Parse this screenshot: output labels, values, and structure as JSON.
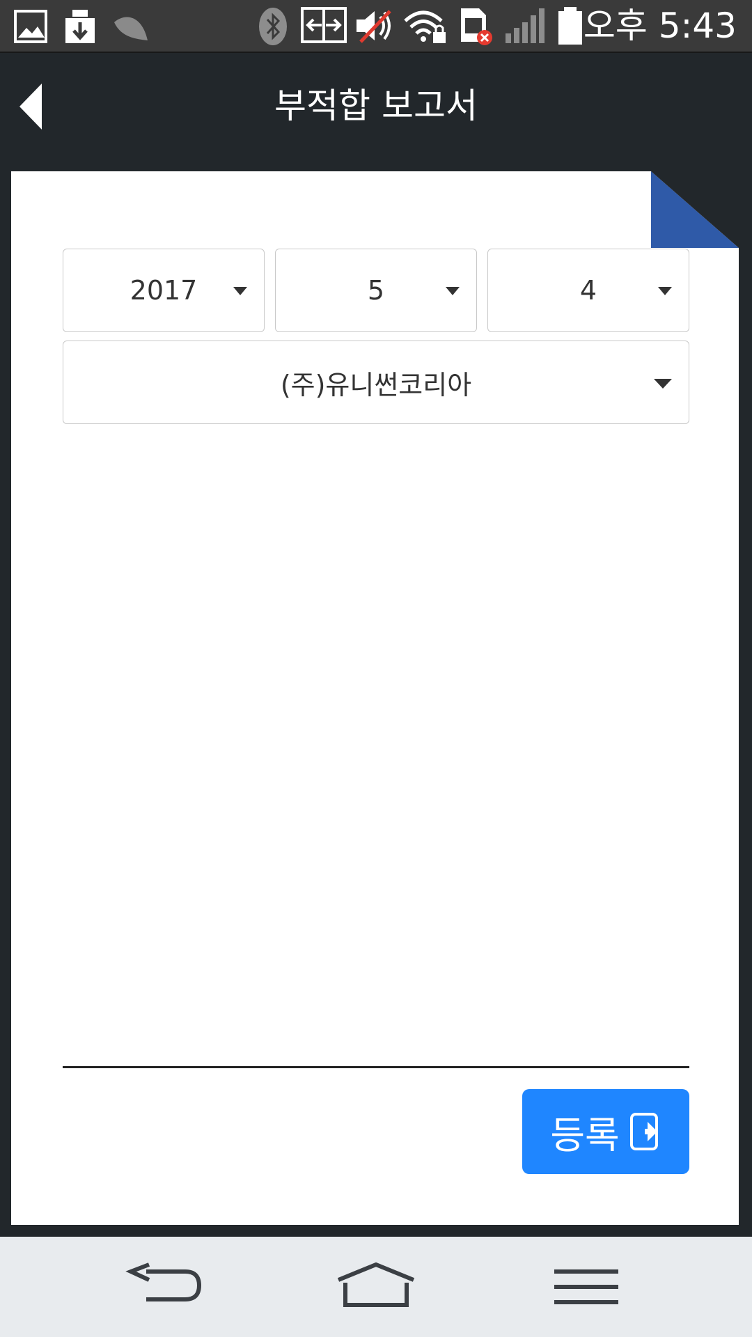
{
  "status_bar": {
    "time": "오후 5:43",
    "icons": [
      "gallery-icon",
      "download-icon",
      "leaf-icon",
      "bluetooth-icon",
      "data-transfer-icon",
      "volume-muted-icon",
      "wifi-lock-icon",
      "sim-error-icon",
      "signal-icon",
      "battery-icon"
    ]
  },
  "header": {
    "title": "부적합 보고서"
  },
  "form": {
    "year": "2017",
    "month": "5",
    "day": "4",
    "company": "(주)유니썬코리아"
  },
  "actions": {
    "register_label": "등록"
  },
  "colors": {
    "accent": "#1f86ff",
    "fold": "#2f5aa8",
    "background": "#22272b"
  }
}
